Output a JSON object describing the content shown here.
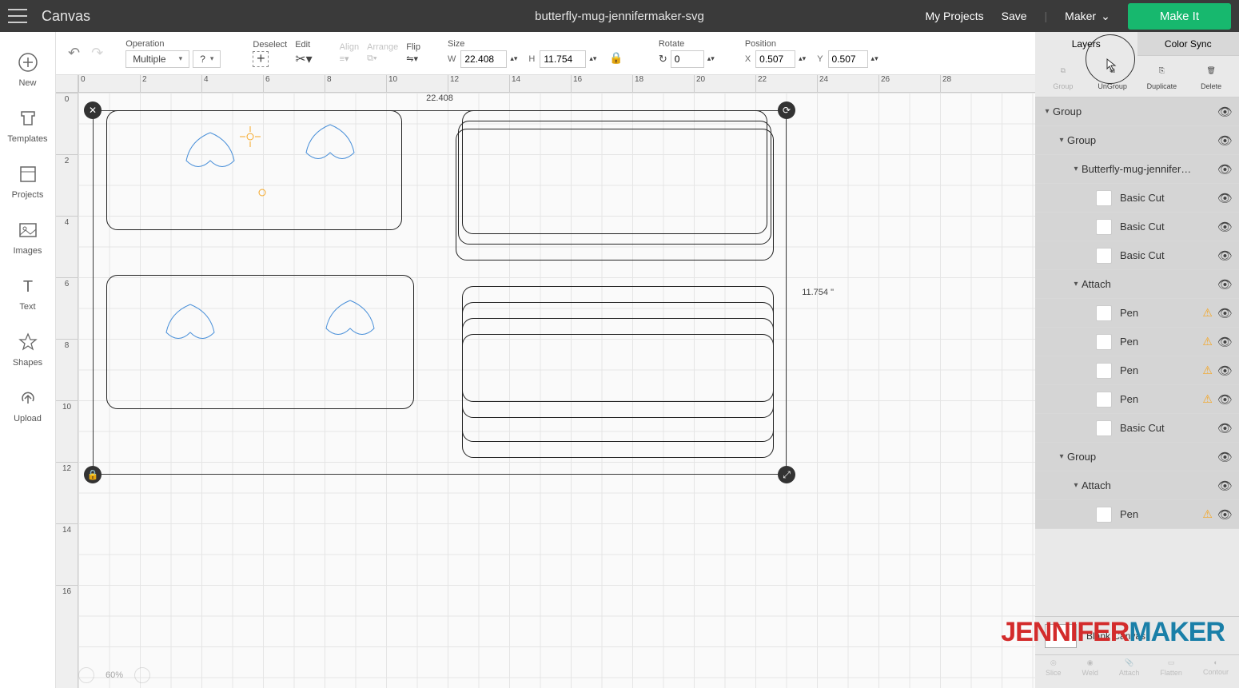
{
  "topbar": {
    "canvas_label": "Canvas",
    "project_title": "butterfly-mug-jennifermaker-svg",
    "my_projects": "My Projects",
    "save": "Save",
    "machine": "Maker",
    "make_it": "Make It"
  },
  "toolbar": {
    "operation_label": "Operation",
    "operation_value": "Multiple",
    "tooltip_q": "?",
    "deselect_label": "Deselect",
    "edit_label": "Edit",
    "align_label": "Align",
    "arrange_label": "Arrange",
    "flip_label": "Flip",
    "size_label": "Size",
    "size_w_label": "W",
    "size_w": "22.408",
    "size_h_label": "H",
    "size_h": "11.754",
    "rotate_label": "Rotate",
    "rotate_val": "0",
    "position_label": "Position",
    "pos_x_label": "X",
    "pos_x": "0.507",
    "pos_y_label": "Y",
    "pos_y": "0.507"
  },
  "leftbar": {
    "new": "New",
    "templates": "Templates",
    "projects": "Projects",
    "images": "Images",
    "text": "Text",
    "shapes": "Shapes",
    "upload": "Upload"
  },
  "canvas": {
    "sel_w": "22.408",
    "sel_h": "11.754 \"",
    "ruler_h": [
      "0",
      "2",
      "4",
      "6",
      "8",
      "10",
      "12",
      "14",
      "16",
      "18",
      "20",
      "22",
      "24",
      "26",
      "28"
    ],
    "ruler_v": [
      "0",
      "2",
      "4",
      "6",
      "8",
      "10",
      "12",
      "14",
      "16"
    ],
    "zoom_pct": "60%"
  },
  "rightpanel": {
    "tab_layers": "Layers",
    "tab_colorsync": "Color Sync",
    "actions": {
      "group": "Group",
      "ungroup": "UnGroup",
      "duplicate": "Duplicate",
      "delete": "Delete"
    },
    "layers": [
      {
        "indent": 0,
        "caret": true,
        "label": "Group",
        "swatch": false,
        "warn": false,
        "selected": true
      },
      {
        "indent": 1,
        "caret": true,
        "label": "Group",
        "swatch": false,
        "warn": false,
        "selected": true
      },
      {
        "indent": 2,
        "caret": true,
        "label": "Butterfly-mug-jennifer…",
        "swatch": false,
        "warn": false,
        "selected": true
      },
      {
        "indent": 3,
        "caret": false,
        "label": "Basic Cut",
        "swatch": true,
        "warn": false,
        "selected": true
      },
      {
        "indent": 3,
        "caret": false,
        "label": "Basic Cut",
        "swatch": true,
        "warn": false,
        "selected": true
      },
      {
        "indent": 3,
        "caret": false,
        "label": "Basic Cut",
        "swatch": true,
        "warn": false,
        "selected": true
      },
      {
        "indent": 2,
        "caret": true,
        "label": "Attach",
        "swatch": false,
        "warn": false,
        "selected": true
      },
      {
        "indent": 3,
        "caret": false,
        "label": "Pen",
        "swatch": true,
        "warn": true,
        "selected": true
      },
      {
        "indent": 3,
        "caret": false,
        "label": "Pen",
        "swatch": true,
        "warn": true,
        "selected": true
      },
      {
        "indent": 3,
        "caret": false,
        "label": "Pen",
        "swatch": true,
        "warn": true,
        "selected": true
      },
      {
        "indent": 3,
        "caret": false,
        "label": "Pen",
        "swatch": true,
        "warn": true,
        "selected": true
      },
      {
        "indent": 3,
        "caret": false,
        "label": "Basic Cut",
        "swatch": true,
        "warn": false,
        "selected": true
      },
      {
        "indent": 1,
        "caret": true,
        "label": "Group",
        "swatch": false,
        "warn": false,
        "selected": true
      },
      {
        "indent": 2,
        "caret": true,
        "label": "Attach",
        "swatch": false,
        "warn": false,
        "selected": true
      },
      {
        "indent": 3,
        "caret": false,
        "label": "Pen",
        "swatch": true,
        "warn": true,
        "selected": true
      }
    ],
    "footer_label": "Blank Canvas",
    "bottom": {
      "slice": "Slice",
      "weld": "Weld",
      "attach": "Attach",
      "flatten": "Flatten",
      "contour": "Contour"
    }
  },
  "watermark": {
    "part1": "JENNIFER",
    "part2": "MAKER"
  }
}
